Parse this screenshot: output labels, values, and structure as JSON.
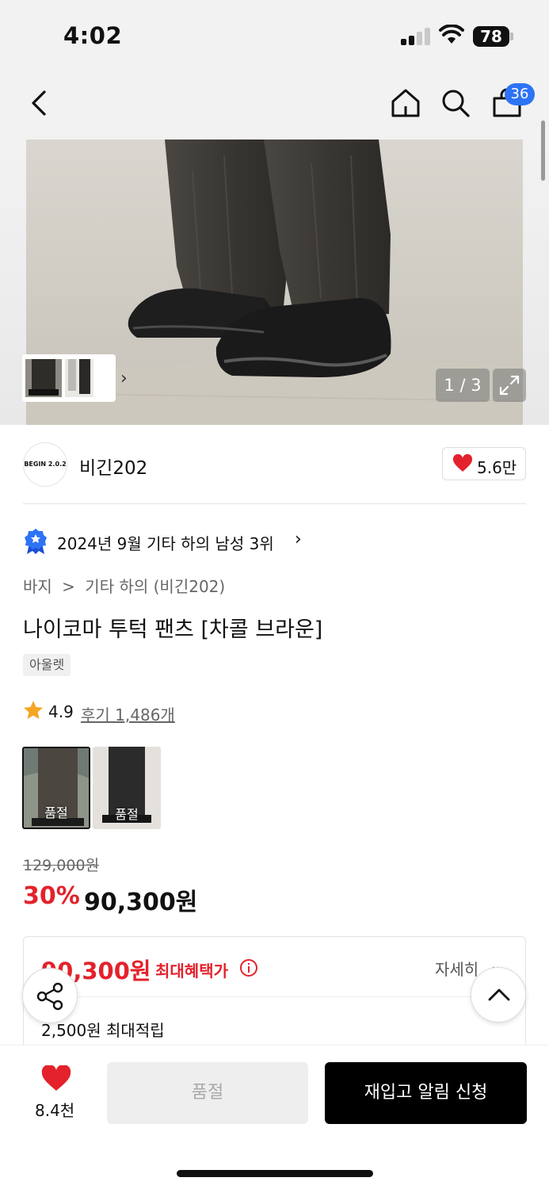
{
  "status_bar": {
    "time": "4:02",
    "battery": "78"
  },
  "header": {
    "cart_count": "36"
  },
  "gallery": {
    "page_indicator": "1 / 3"
  },
  "brand": {
    "logo_text": "BEGIN 2.0.2",
    "name": "비긴202",
    "likes": "5.6만"
  },
  "ranking": {
    "text": "2024년 9월 기타 하의 남성 3위",
    "arrow": "›"
  },
  "breadcrumb": {
    "category": "바지",
    "separator": ">",
    "sub": "기타 하의 (비긴202)"
  },
  "product": {
    "title": "나이코마 투턱 팬츠 [차콜 브라운]",
    "tag": "아울렛",
    "rating": "4.9",
    "reviews": "후기 1,486개",
    "options": [
      {
        "label": "품절"
      },
      {
        "label": "품절"
      }
    ]
  },
  "price": {
    "original": "129,000원",
    "discount": "30%",
    "sale": "90,300원"
  },
  "benefit": {
    "max_price": "90,300원",
    "max_label": "최대혜택가",
    "detail": "자세히",
    "points": "2,500원 최대적립"
  },
  "bottom_bar": {
    "likes": "8.4천",
    "soldout": "품절",
    "restock": "재입고 알림 신청"
  },
  "colors": {
    "accent_red": "#e3222b",
    "badge_blue": "#2d73f5",
    "cta_black": "#000000"
  }
}
